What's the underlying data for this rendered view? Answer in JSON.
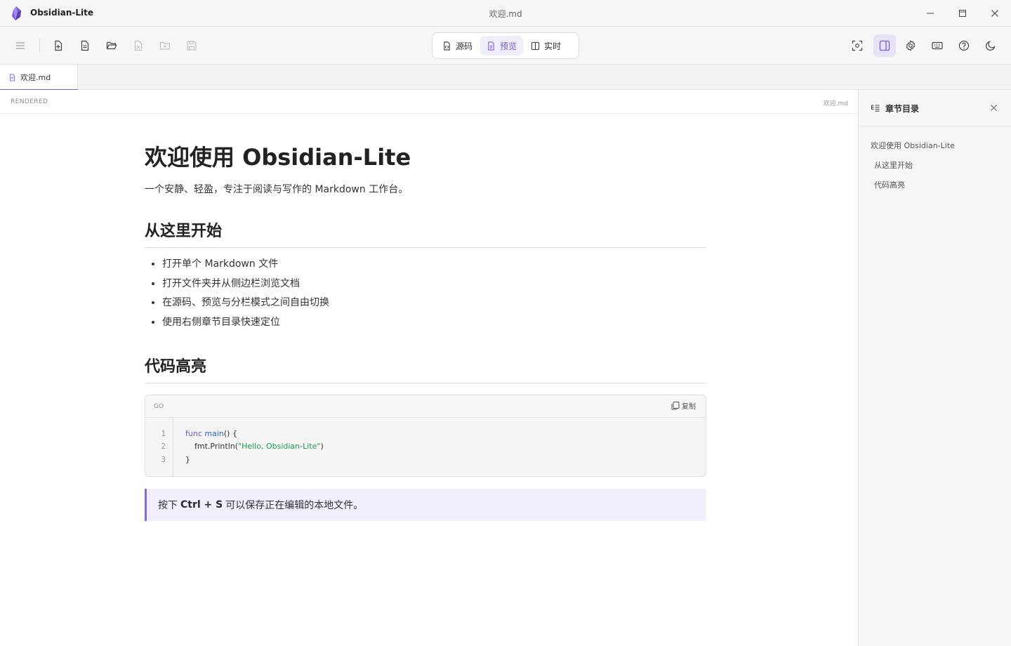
{
  "app": {
    "name": "Obsidian-Lite",
    "window_title": "欢迎.md",
    "accent": "#7c5cd6"
  },
  "toolbar": {
    "left_icons": [
      "menu-icon",
      "new-file-icon",
      "file-icon",
      "folder-open-icon",
      "close-file-icon",
      "close-folder-icon",
      "save-icon"
    ],
    "modes": [
      {
        "label": "源码",
        "icon": "source-icon",
        "active": false
      },
      {
        "label": "预览",
        "icon": "preview-icon",
        "active": true
      },
      {
        "label": "实时",
        "icon": "split-icon",
        "active": false
      }
    ],
    "right_icons": [
      "focus-icon",
      "sidebar-toggle-icon",
      "gear-icon",
      "keyboard-icon",
      "help-icon",
      "moon-icon"
    ]
  },
  "tabs": [
    {
      "label": "欢迎.md",
      "active": true
    }
  ],
  "editor": {
    "mode_label": "RENDERED",
    "file_label": "欢迎.md"
  },
  "doc": {
    "title": "欢迎使用 Obsidian-Lite",
    "lead": "一个安静、轻盈，专注于阅读与写作的 Markdown 工作台。",
    "section1": {
      "heading": "从这里开始",
      "items": [
        "打开单个 Markdown 文件",
        "打开文件夹并从侧边栏浏览文档",
        "在源码、预览与分栏模式之间自由切换",
        "使用右侧章节目录快速定位"
      ]
    },
    "section2": {
      "heading": "代码高亮",
      "code": {
        "lang": "GO",
        "copy_label": "复制",
        "line_numbers": [
          "1",
          "2",
          "3"
        ],
        "line1_kw": "func",
        "line1_fn": "main",
        "line1_rest": "() {",
        "line2_pre": "fmt.Println(",
        "line2_str": "\"Hello, Obsidian-Lite\"",
        "line2_post": ")",
        "line3": "}"
      }
    },
    "callout": {
      "pre": "按下",
      "keys": "Ctrl + S",
      "post": "可以保存正在编辑的本地文件。"
    }
  },
  "outline": {
    "title": "章节目录",
    "items": [
      "欢迎使用 Obsidian-Lite",
      "从这里开始",
      "代码高亮"
    ]
  }
}
